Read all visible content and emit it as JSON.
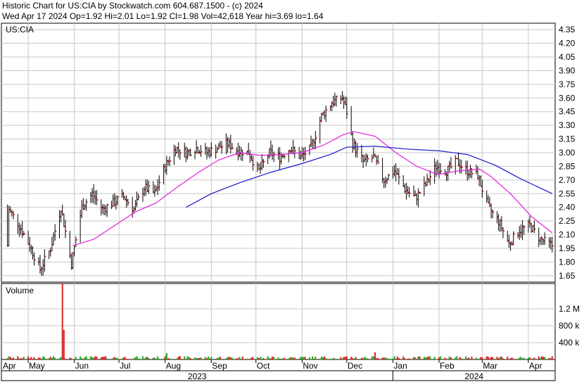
{
  "header": {
    "line1": "Historic Chart for US:CIA by Stockwatch.com 604.687.1500 - (c) 2024",
    "line2": "Wed Apr 17 2024  Op=1.92  Hi=2.01  Lo=1.92  Cl=1.98  Vol=42,618  Year hi=3.69  lo=1.64"
  },
  "price_panel": {
    "label": "US:CIA"
  },
  "volume_panel": {
    "label": "Volume"
  },
  "colors": {
    "grid": "#c8c8c8",
    "bar": "#000000",
    "close_tick": "#c00000",
    "ma_short": "#e020e0",
    "ma_long": "#1a1acc",
    "vol_up": "#22aa22",
    "vol_down": "#dd2222"
  },
  "chart_data": [
    {
      "type": "ohlc",
      "title": "US:CIA",
      "ylim": [
        1.58,
        4.42
      ],
      "y_ticks": [
        "4.35",
        "4.20",
        "4.05",
        "3.90",
        "3.75",
        "3.60",
        "3.45",
        "3.30",
        "3.15",
        "3.00",
        "2.85",
        "2.70",
        "2.55",
        "2.40",
        "2.25",
        "2.10",
        "1.95",
        "1.80",
        "1.65"
      ],
      "x_month_labels": [
        "Apr",
        "May",
        "Jun",
        "Jul",
        "Aug",
        "Sep",
        "Oct",
        "Nov",
        "Dec",
        "Jan",
        "Feb",
        "Mar",
        "Apr"
      ],
      "year_labels": [
        "2023",
        "2024"
      ],
      "series": [
        {
          "name": "close",
          "points": [
            [
              "2023-04-18",
              2.38
            ],
            [
              "2023-04-25",
              2.2
            ],
            [
              "2023-05-02",
              1.98
            ],
            [
              "2023-05-09",
              1.72
            ],
            [
              "2023-05-16",
              1.95
            ],
            [
              "2023-05-23",
              2.4
            ],
            [
              "2023-05-30",
              1.78
            ],
            [
              "2023-06-06",
              2.4
            ],
            [
              "2023-06-13",
              2.55
            ],
            [
              "2023-06-20",
              2.38
            ],
            [
              "2023-06-27",
              2.45
            ],
            [
              "2023-07-04",
              2.52
            ],
            [
              "2023-07-11",
              2.38
            ],
            [
              "2023-07-18",
              2.62
            ],
            [
              "2023-07-25",
              2.55
            ],
            [
              "2023-08-01",
              2.85
            ],
            [
              "2023-08-08",
              3.05
            ],
            [
              "2023-08-15",
              3.0
            ],
            [
              "2023-08-22",
              3.05
            ],
            [
              "2023-08-29",
              3.0
            ],
            [
              "2023-09-05",
              3.05
            ],
            [
              "2023-09-12",
              3.1
            ],
            [
              "2023-09-19",
              3.02
            ],
            [
              "2023-09-26",
              3.0
            ],
            [
              "2023-10-03",
              2.8
            ],
            [
              "2023-10-10",
              3.0
            ],
            [
              "2023-10-17",
              2.95
            ],
            [
              "2023-10-24",
              3.05
            ],
            [
              "2023-10-31",
              2.95
            ],
            [
              "2023-11-07",
              3.05
            ],
            [
              "2023-11-14",
              3.4
            ],
            [
              "2023-11-21",
              3.55
            ],
            [
              "2023-11-28",
              3.6
            ],
            [
              "2023-12-01",
              3.45
            ],
            [
              "2023-12-05",
              3.1
            ],
            [
              "2023-12-12",
              2.9
            ],
            [
              "2023-12-19",
              2.95
            ],
            [
              "2023-12-26",
              2.7
            ],
            [
              "2024-01-02",
              2.8
            ],
            [
              "2024-01-09",
              2.6
            ],
            [
              "2024-01-16",
              2.5
            ],
            [
              "2024-01-23",
              2.65
            ],
            [
              "2024-01-30",
              2.85
            ],
            [
              "2024-02-06",
              2.8
            ],
            [
              "2024-02-13",
              2.9
            ],
            [
              "2024-02-20",
              2.8
            ],
            [
              "2024-02-27",
              2.75
            ],
            [
              "2024-03-05",
              2.4
            ],
            [
              "2024-03-12",
              2.25
            ],
            [
              "2024-03-19",
              2.0
            ],
            [
              "2024-03-26",
              2.15
            ],
            [
              "2024-04-02",
              2.2
            ],
            [
              "2024-04-09",
              2.05
            ],
            [
              "2024-04-17",
              1.98
            ]
          ]
        },
        {
          "name": "moving average (short)",
          "points": [
            [
              "2023-05-31",
              1.98
            ],
            [
              "2023-06-14",
              2.05
            ],
            [
              "2023-06-28",
              2.2
            ],
            [
              "2023-07-12",
              2.35
            ],
            [
              "2023-07-26",
              2.45
            ],
            [
              "2023-08-09",
              2.62
            ],
            [
              "2023-08-23",
              2.78
            ],
            [
              "2023-09-06",
              2.92
            ],
            [
              "2023-09-20",
              3.0
            ],
            [
              "2023-10-04",
              2.97
            ],
            [
              "2023-10-18",
              2.98
            ],
            [
              "2023-11-01",
              3.0
            ],
            [
              "2023-11-15",
              3.08
            ],
            [
              "2023-11-29",
              3.2
            ],
            [
              "2023-12-06",
              3.23
            ],
            [
              "2023-12-20",
              3.18
            ],
            [
              "2024-01-03",
              3.0
            ],
            [
              "2024-01-17",
              2.85
            ],
            [
              "2024-01-31",
              2.76
            ],
            [
              "2024-02-14",
              2.8
            ],
            [
              "2024-02-28",
              2.82
            ],
            [
              "2024-03-06",
              2.75
            ],
            [
              "2024-03-20",
              2.55
            ],
            [
              "2024-04-03",
              2.3
            ],
            [
              "2024-04-17",
              2.12
            ]
          ]
        },
        {
          "name": "moving average (long)",
          "points": [
            [
              "2023-08-15",
              2.4
            ],
            [
              "2023-09-01",
              2.55
            ],
            [
              "2023-09-20",
              2.67
            ],
            [
              "2023-10-10",
              2.78
            ],
            [
              "2023-11-01",
              2.88
            ],
            [
              "2023-11-20",
              2.98
            ],
            [
              "2023-12-01",
              3.06
            ],
            [
              "2023-12-20",
              3.07
            ],
            [
              "2024-01-10",
              3.04
            ],
            [
              "2024-02-01",
              3.02
            ],
            [
              "2024-02-20",
              2.98
            ],
            [
              "2024-03-10",
              2.86
            ],
            [
              "2024-03-26",
              2.72
            ],
            [
              "2024-04-17",
              2.55
            ]
          ]
        }
      ]
    },
    {
      "type": "bar",
      "title": "Volume",
      "y_ticks": [
        "1.2 M",
        "800 k",
        "400 k"
      ],
      "ylim": [
        0,
        1800000
      ],
      "spikes": [
        [
          "2023-05-24",
          1800000
        ],
        [
          "2023-05-25",
          700000
        ],
        [
          "2023-08-02",
          150000
        ],
        [
          "2023-12-20",
          170000
        ]
      ],
      "typical_volume": 50000
    }
  ]
}
